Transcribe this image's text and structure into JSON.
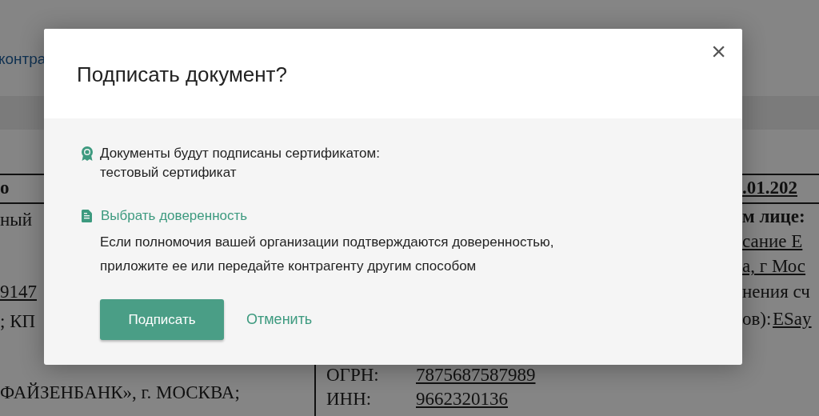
{
  "background": {
    "fragments": [
      {
        "text": "контра",
        "kind": "link"
      },
      {
        "text": "о",
        "kind": "bold"
      },
      {
        "text": "ный",
        "kind": "plain"
      },
      {
        "text": "9147",
        "kind": "underlined"
      },
      {
        "text": "; КП",
        "kind": "plain"
      },
      {
        "text": "ФАЙЗЕНБАНК», г. МОСКВА;",
        "kind": "plain"
      },
      {
        "text": ".01.202",
        "kind": "bold-underlined"
      },
      {
        "text": "м лице:",
        "kind": "bold"
      },
      {
        "text": "сание Е",
        "kind": "underlined"
      },
      {
        "text": "а, г Мос",
        "kind": "underlined"
      },
      {
        "text": "нения сч",
        "kind": "plain"
      },
      {
        "text": "ов):",
        "kind": "plain"
      },
      {
        "text": "ESay",
        "kind": "underlined"
      },
      {
        "text": "ОГРН:",
        "kind": "plain"
      },
      {
        "text": "7875687587989",
        "kind": "underlined"
      },
      {
        "text": "ИНН:",
        "kind": "plain"
      },
      {
        "text": "9662320136",
        "kind": "underlined"
      }
    ]
  },
  "dialog": {
    "title": "Подписать документ?",
    "close": "×",
    "certificate": {
      "label": "Документы будут подписаны сертификатом:",
      "name": "тестовый сертификат"
    },
    "power_of_attorney_link": "Выбрать доверенность",
    "note": "Если полномочия вашей организации подтверждаются доверенностью,\nприложите ее или передайте контрагенту другим способом",
    "buttons": [
      {
        "label": "Подписать",
        "kind": "primary"
      },
      {
        "label": "Отменить",
        "kind": "link"
      }
    ]
  }
}
